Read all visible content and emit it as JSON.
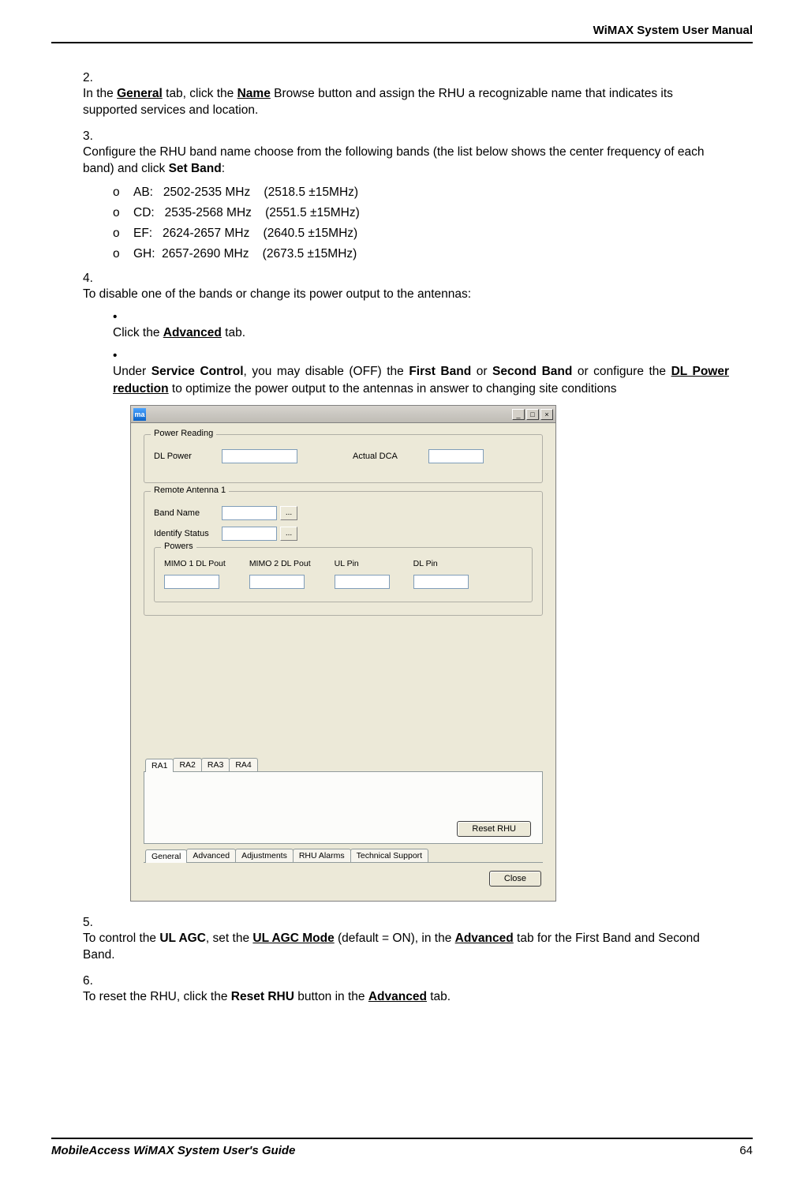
{
  "header": {
    "title": "WiMAX System User Manual"
  },
  "footer": {
    "guide_title": "MobileAccess WiMAX System User's Guide",
    "page_number": "64"
  },
  "steps": {
    "s2": {
      "num": "2.",
      "text_parts": [
        "In the ",
        "General",
        " tab, click the ",
        "Name",
        " Browse button and assign the RHU a recognizable name that indicates its supported services and location."
      ]
    },
    "s3": {
      "num": "3.",
      "text_parts": [
        "Configure the RHU band name choose from the following bands (the list below shows the center frequency of each band) and click ",
        "Set Band",
        ":"
      ],
      "bands": [
        "AB:   2502-2535 MHz    (2518.5 ±15MHz)",
        "CD:   2535-2568 MHz    (2551.5 ±15MHz)",
        "EF:   2624-2657 MHz    (2640.5 ±15MHz)",
        "GH:  2657-2690 MHz    (2673.5 ±15MHz)"
      ]
    },
    "s4": {
      "num": "4.",
      "text": "To disable one of the bands or change its power output to the antennas:",
      "b1_parts": [
        "Click the ",
        "Advanced",
        " tab."
      ],
      "b2_parts": [
        "Under ",
        "Service Control",
        ", you may disable (OFF) the ",
        "First Band",
        " or ",
        "Second Band",
        " or configure the ",
        "DL Power reduction",
        " to optimize the power output to the antennas in answer to changing site conditions"
      ]
    },
    "s5": {
      "num": "5.",
      "text_parts": [
        "To control the ",
        "UL AGC",
        ", set the ",
        "UL AGC Mode",
        " (default = ON), in the ",
        "Advanced",
        " tab for the First Band and Second Band."
      ]
    },
    "s6": {
      "num": "6.",
      "text_parts": [
        "To reset the RHU, click the ",
        "Reset RHU",
        " button in the ",
        "Advanced",
        " tab."
      ]
    },
    "o_marker": "o",
    "bullet_marker": "•"
  },
  "dialog": {
    "title_icon": "ma",
    "power_reading": {
      "title": "Power Reading",
      "dl_power": "DL Power",
      "actual_dca": "Actual DCA"
    },
    "remote_antenna": {
      "title": "Remote Antenna 1",
      "band_name": "Band Name",
      "identify_status": "Identify Status",
      "browse": "..."
    },
    "powers": {
      "title": "Powers",
      "cols": [
        "MIMO 1 DL Pout",
        "MIMO 2 DL Pout",
        "UL Pin",
        "DL Pin"
      ]
    },
    "ra_tabs": [
      "RA1",
      "RA2",
      "RA3",
      "RA4"
    ],
    "bottom_tabs": [
      "General",
      "Advanced",
      "Adjustments",
      "RHU Alarms",
      "Technical Support"
    ],
    "reset_button": "Reset RHU",
    "close_button": "Close",
    "win_controls": {
      "min": "_",
      "max": "□",
      "close": "×"
    }
  }
}
